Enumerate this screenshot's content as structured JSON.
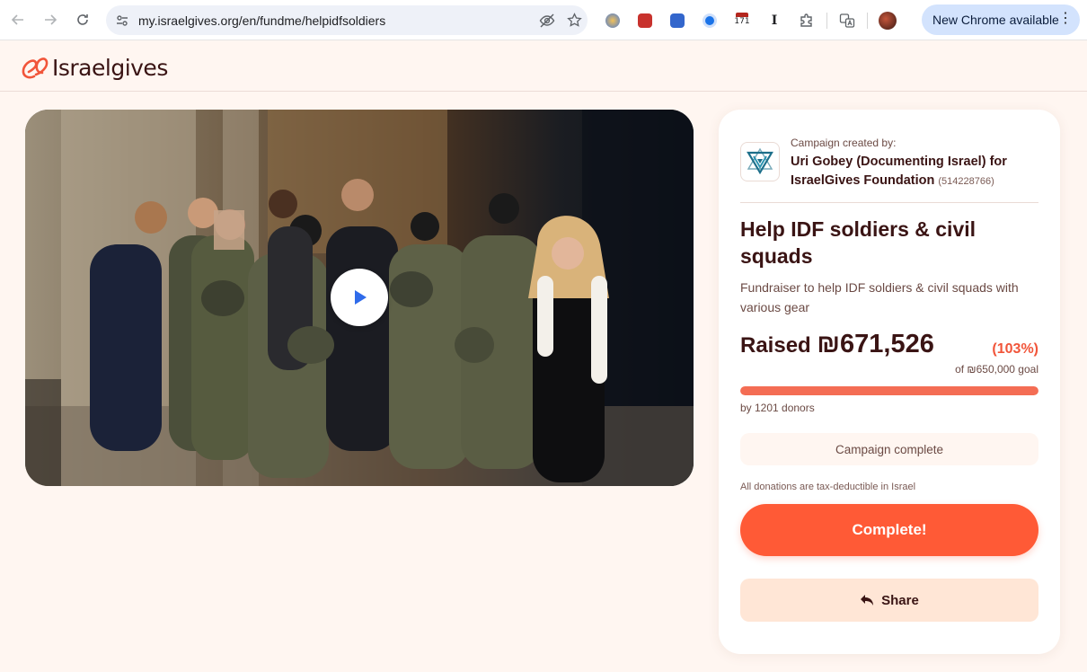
{
  "browser": {
    "url": "my.israelgives.org/en/fundme/helpidfsoldiers",
    "new_chrome_label": "New Chrome available",
    "extension_badge": "171",
    "icons": [
      "back-icon",
      "forward-icon",
      "reload-icon",
      "site-settings-icon",
      "eye-off-icon",
      "star-icon",
      "extensions-puzzle-icon",
      "translate-icon",
      "kebab-menu-icon"
    ]
  },
  "site": {
    "logo_text": "Israelgives",
    "brand_color": "#f1553a",
    "text_color": "#3a1414"
  },
  "media": {
    "play_icon": "play-icon"
  },
  "campaign": {
    "created_by_label": "Campaign created by:",
    "organizer": "Uri Gobey (Documenting Israel) for IsraelGives Foundation",
    "org_id": "(514228766)",
    "title": "Help IDF soldiers & civil squads",
    "subtitle": "Fundraiser to help IDF soldiers & civil squads with various gear",
    "raised_label": "Raised",
    "raised_amount": "₪671,526",
    "percent": "(103%)",
    "goal": "of ₪650,000 goal",
    "progress_fraction": 1.0,
    "donors": "by 1201 donors",
    "status": "Campaign complete",
    "tax_note": "All donations are tax-deductible in Israel",
    "complete_button": "Complete!",
    "share_button": "Share"
  }
}
